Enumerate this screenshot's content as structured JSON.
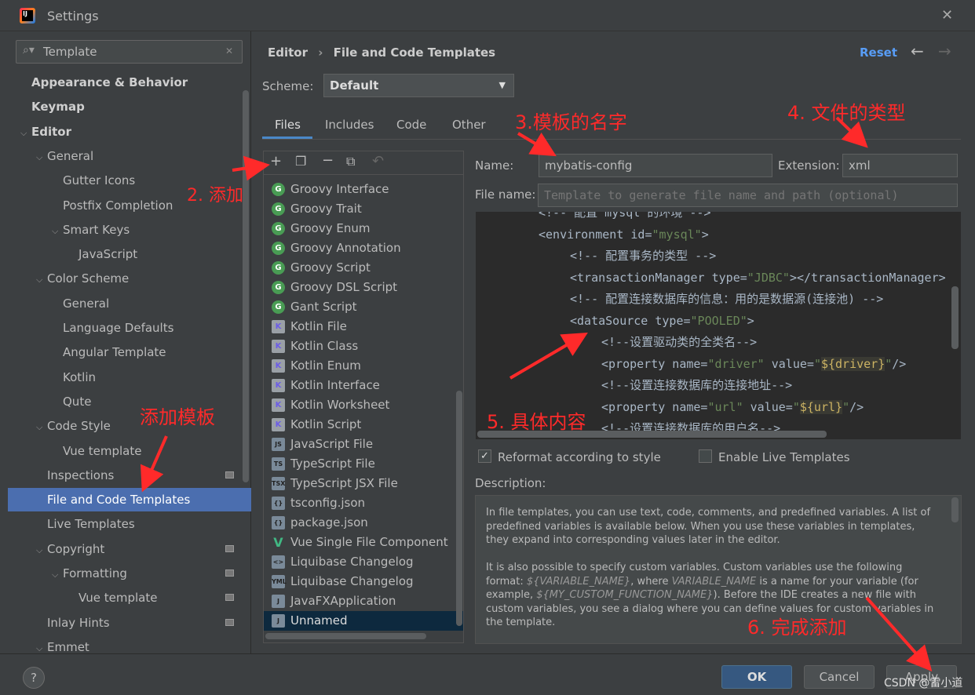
{
  "window": {
    "title": "Settings",
    "close": "✕"
  },
  "search": {
    "value": "Template"
  },
  "tree": [
    {
      "label": "Appearance & Behavior",
      "level": 0,
      "bold": true
    },
    {
      "label": "Keymap",
      "level": 0,
      "bold": true
    },
    {
      "label": "Editor",
      "level": 0,
      "bold": true,
      "expanded": true
    },
    {
      "label": "General",
      "level": 1,
      "expanded": true
    },
    {
      "label": "Gutter Icons",
      "level": 2
    },
    {
      "label": "Postfix Completion",
      "level": 2
    },
    {
      "label": "Smart Keys",
      "level": 2,
      "expanded": true
    },
    {
      "label": "JavaScript",
      "level": 3
    },
    {
      "label": "Color Scheme",
      "level": 1,
      "expanded": true
    },
    {
      "label": "General",
      "level": 2
    },
    {
      "label": "Language Defaults",
      "level": 2
    },
    {
      "label": "Angular Template",
      "level": 2
    },
    {
      "label": "Kotlin",
      "level": 2
    },
    {
      "label": "Qute",
      "level": 2
    },
    {
      "label": "Code Style",
      "level": 1,
      "expanded": true
    },
    {
      "label": "Vue template",
      "level": 2
    },
    {
      "label": "Inspections",
      "level": 1,
      "badge": true
    },
    {
      "label": "File and Code Templates",
      "level": 1,
      "selected": true
    },
    {
      "label": "Live Templates",
      "level": 1
    },
    {
      "label": "Copyright",
      "level": 1,
      "expanded": true,
      "badge": true
    },
    {
      "label": "Formatting",
      "level": 2,
      "expanded": true,
      "badge": true
    },
    {
      "label": "Vue template",
      "level": 3,
      "badge": true
    },
    {
      "label": "Inlay Hints",
      "level": 1,
      "badge": true
    },
    {
      "label": "Emmet",
      "level": 1,
      "expanded": true
    }
  ],
  "breadcrumb": {
    "parent": "Editor",
    "sep": "›",
    "current": "File and Code Templates"
  },
  "header": {
    "reset": "Reset"
  },
  "scheme": {
    "label": "Scheme:",
    "value": "Default"
  },
  "tabs": [
    "Files",
    "Includes",
    "Code",
    "Other"
  ],
  "files": [
    {
      "label": "Groovy Interface",
      "icon": "g"
    },
    {
      "label": "Groovy Trait",
      "icon": "g"
    },
    {
      "label": "Groovy Enum",
      "icon": "g"
    },
    {
      "label": "Groovy Annotation",
      "icon": "g"
    },
    {
      "label": "Groovy Script",
      "icon": "g"
    },
    {
      "label": "Groovy DSL Script",
      "icon": "g"
    },
    {
      "label": "Gant Script",
      "icon": "g"
    },
    {
      "label": "Kotlin File",
      "icon": "k"
    },
    {
      "label": "Kotlin Class",
      "icon": "k"
    },
    {
      "label": "Kotlin Enum",
      "icon": "k"
    },
    {
      "label": "Kotlin Interface",
      "icon": "k"
    },
    {
      "label": "Kotlin Worksheet",
      "icon": "k"
    },
    {
      "label": "Kotlin Script",
      "icon": "k"
    },
    {
      "label": "JavaScript File",
      "icon": "JS"
    },
    {
      "label": "TypeScript File",
      "icon": "TS"
    },
    {
      "label": "TypeScript JSX File",
      "icon": "TSX"
    },
    {
      "label": "tsconfig.json",
      "icon": "{}"
    },
    {
      "label": "package.json",
      "icon": "{}"
    },
    {
      "label": "Vue Single File Component",
      "icon": "v"
    },
    {
      "label": "Liquibase Changelog",
      "icon": "<>"
    },
    {
      "label": "Liquibase Changelog",
      "icon": "YML"
    },
    {
      "label": "JavaFXApplication",
      "icon": "J"
    },
    {
      "label": "Unnamed",
      "icon": "J",
      "selected": true
    }
  ],
  "form": {
    "name_label": "Name:",
    "name_value": "mybatis-config",
    "ext_label": "Extension:",
    "ext_value": "xml",
    "filename_label": "File name:",
    "filename_placeholder": "Template to generate file name and path (optional)"
  },
  "code": [
    {
      "indent": 2,
      "parts": [
        [
          "c",
          "<!-- 配置 mysql 的环境 -->"
        ]
      ]
    },
    {
      "indent": 2,
      "parts": [
        [
          "c",
          "<environment id="
        ],
        [
          "s",
          "\"mysql\""
        ],
        [
          "c",
          ">"
        ]
      ]
    },
    {
      "indent": 3,
      "parts": [
        [
          "c",
          "<!-- 配置事务的类型 -->"
        ]
      ]
    },
    {
      "indent": 3,
      "parts": [
        [
          "c",
          "<transactionManager type="
        ],
        [
          "s",
          "\"JDBC\""
        ],
        [
          "c",
          "></transactionManager>"
        ]
      ]
    },
    {
      "indent": 3,
      "parts": [
        [
          "c",
          "<!-- 配置连接数据库的信息：用的是数据源(连接池) -->"
        ]
      ]
    },
    {
      "indent": 3,
      "parts": [
        [
          "c",
          "<dataSource type="
        ],
        [
          "s",
          "\"POOLED\""
        ],
        [
          "c",
          ">"
        ]
      ]
    },
    {
      "indent": 4,
      "parts": [
        [
          "c",
          "<!--设置驱动类的全类名-->"
        ]
      ]
    },
    {
      "indent": 4,
      "parts": [
        [
          "c",
          "<property name="
        ],
        [
          "s",
          "\"driver\""
        ],
        [
          "c",
          " value="
        ],
        [
          "s",
          "\""
        ],
        [
          "v",
          "${driver}"
        ],
        [
          "s",
          "\""
        ],
        [
          "c",
          "/>"
        ]
      ]
    },
    {
      "indent": 4,
      "parts": [
        [
          "c",
          "<!--设置连接数据库的连接地址-->"
        ]
      ]
    },
    {
      "indent": 4,
      "parts": [
        [
          "c",
          "<property name="
        ],
        [
          "s",
          "\"url\""
        ],
        [
          "c",
          " value="
        ],
        [
          "s",
          "\""
        ],
        [
          "v",
          "${url}"
        ],
        [
          "s",
          "\""
        ],
        [
          "c",
          "/>"
        ]
      ]
    },
    {
      "indent": 4,
      "parts": [
        [
          "c",
          "<!--设置连接数据库的用户名-->"
        ]
      ]
    }
  ],
  "options": {
    "reformat": "Reformat according to style",
    "reformat_checked": true,
    "live": "Enable Live Templates",
    "live_checked": false
  },
  "description": {
    "label": "Description:",
    "p1": "In file templates, you can use text, code, comments, and predefined variables. A list of predefined variables is available below. When you use these variables in templates, they expand into corresponding values later in the editor.",
    "p2a": "It is also possible to specify custom variables. Custom variables use the following format: ",
    "p2v1": "${VARIABLE_NAME}",
    "p2b": ", where ",
    "p2v2": "VARIABLE_NAME",
    "p2c": " is a name for your variable (for example, ",
    "p2v3": "${MY_CUSTOM_FUNCTION_NAME}",
    "p2d": "). Before the IDE creates a new file with custom variables, you see a dialog where you can define values for custom variables in the template."
  },
  "buttons": {
    "help": "?",
    "ok": "OK",
    "cancel": "Cancel",
    "apply": "Apply"
  },
  "annotations": {
    "a2": "2. 添加",
    "a3": "3.模板的名字",
    "a4": "4. 文件的类型",
    "a5": "5. 具体内容",
    "a6": "6. 完成添加",
    "side": "添加模板",
    "color": "#ff2a2a"
  },
  "watermark": "CSDN @雷小道",
  "colors": {
    "selection": "#4b6eaf",
    "editor": "#2b2b2b",
    "panel": "#3c3f41"
  }
}
